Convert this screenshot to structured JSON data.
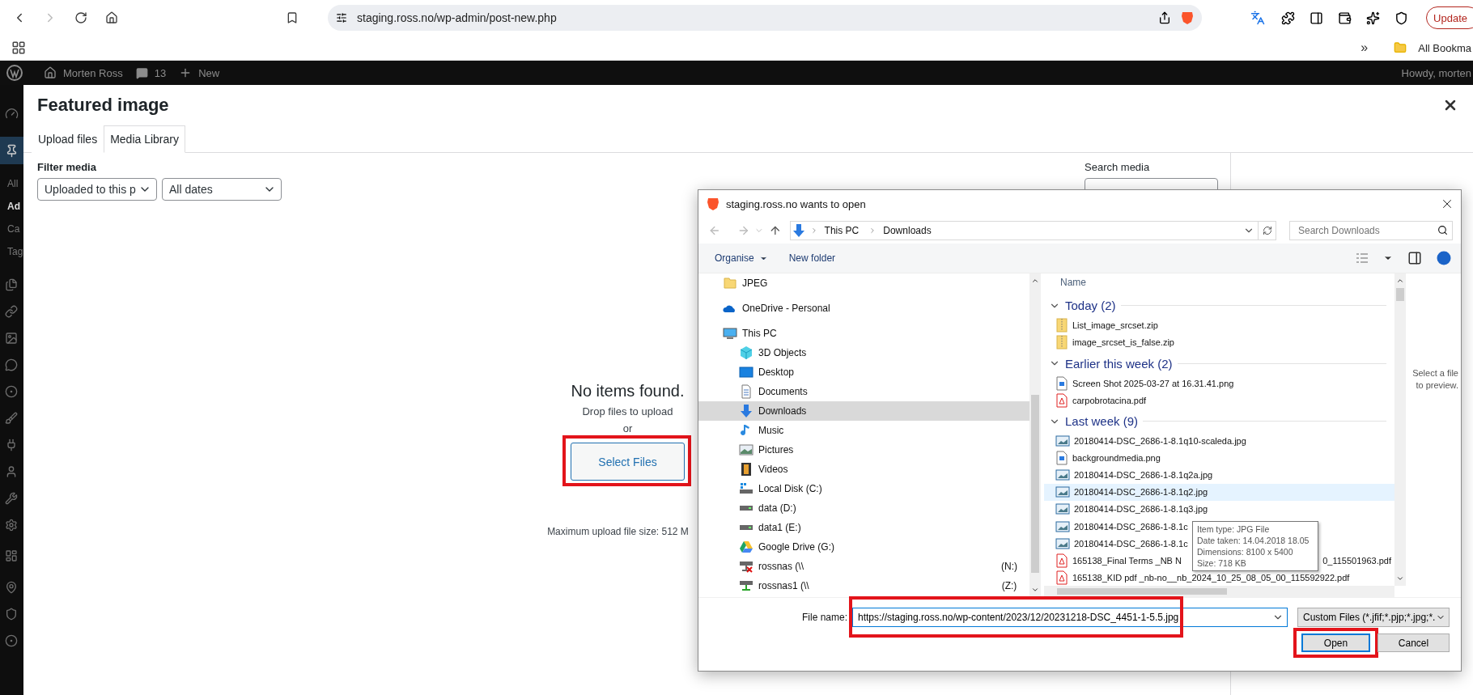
{
  "browser": {
    "url": "staging.ross.no/wp-admin/post-new.php",
    "update_button": "Update",
    "bookmarks_overflow": "»",
    "bookmarks_folder": "All Bookma"
  },
  "admin_bar": {
    "site": "Morten Ross",
    "comments": "13",
    "new": "New",
    "greeting": "Howdy, morten"
  },
  "sidebar": {
    "items": [
      {
        "label": "All",
        "selected": false
      },
      {
        "label": "Ad",
        "selected": true
      },
      {
        "label": "Ca",
        "selected": false
      },
      {
        "label": "Tag",
        "selected": false
      }
    ]
  },
  "modal": {
    "title": "Featured image",
    "tabs": [
      {
        "label": "Upload files",
        "selected": false
      },
      {
        "label": "Media Library",
        "selected": true
      }
    ],
    "filter_label": "Filter media",
    "filters": [
      "Uploaded to this p",
      "All dates"
    ],
    "search_label": "Search media",
    "empty": {
      "title": "No items found.",
      "hint": "Drop files to upload",
      "or": "or",
      "button": {
        "label": "Select Files",
        "highlighted": true
      },
      "max_size": "Maximum upload file size: 512 M"
    }
  },
  "dialog": {
    "title": "staging.ross.no wants to open",
    "path": [
      "This PC",
      "Downloads"
    ],
    "search_placeholder": "Search Downloads",
    "toolbar": {
      "organise": "Organise",
      "new_folder": "New folder"
    },
    "nav_items": [
      {
        "label": "JPEG",
        "kind": "folder",
        "selected": false
      },
      {
        "label": "OneDrive - Personal",
        "kind": "cloud",
        "selected": false
      },
      {
        "label": "This PC",
        "kind": "pc",
        "selected": false,
        "children": [
          {
            "label": "3D Objects",
            "kind": "cube",
            "selected": false
          },
          {
            "label": "Desktop",
            "kind": "desktop",
            "selected": false
          },
          {
            "label": "Documents",
            "kind": "document",
            "selected": false
          },
          {
            "label": "Downloads",
            "kind": "download",
            "selected": true
          },
          {
            "label": "Music",
            "kind": "music",
            "selected": false
          },
          {
            "label": "Pictures",
            "kind": "pictures",
            "selected": false
          },
          {
            "label": "Videos",
            "kind": "video",
            "selected": false
          },
          {
            "label": "Local Disk (C:)",
            "kind": "system-disk",
            "selected": false
          },
          {
            "label": "data (D:)",
            "kind": "disk",
            "selected": false
          },
          {
            "label": "data1 (E:)",
            "kind": "disk",
            "selected": false
          },
          {
            "label": "Google Drive (G:)",
            "kind": "gdrive",
            "selected": false
          },
          {
            "label": "rossnas (\\\\",
            "label_end": "(N:)",
            "kind": "network-drive",
            "disconnected": true,
            "selected": false
          },
          {
            "label": "rossnas1 (\\\\",
            "label_end": "(Z:)",
            "kind": "network-drive",
            "disconnected": false,
            "selected": false
          }
        ]
      }
    ],
    "column": "Name",
    "groups": [
      {
        "label": "Today (2)",
        "expanded": true,
        "files": [
          {
            "name": "List_image_srcset.zip",
            "kind": "zip",
            "selected": false
          },
          {
            "name": "image_srcset_is_false.zip",
            "kind": "zip",
            "selected": false
          }
        ]
      },
      {
        "label": "Earlier this week (2)",
        "expanded": true,
        "files": [
          {
            "name": "Screen Shot 2025-03-27 at 16.31.41.png",
            "kind": "png",
            "selected": false
          },
          {
            "name": "carpobrotacina.pdf",
            "kind": "pdf",
            "selected": false
          }
        ]
      },
      {
        "label": "Last week (9)",
        "expanded": true,
        "files": [
          {
            "name": "20180414-DSC_2686-1-8.1q10-scaleda.jpg",
            "kind": "jpg",
            "selected": false
          },
          {
            "name": "backgroundmedia.png",
            "kind": "png",
            "selected": false
          },
          {
            "name": "20180414-DSC_2686-1-8.1q2a.jpg",
            "kind": "jpg",
            "selected": false
          },
          {
            "name": "20180414-DSC_2686-1-8.1q2.jpg",
            "kind": "jpg",
            "selected": true
          },
          {
            "name": "20180414-DSC_2686-1-8.1q3.jpg",
            "kind": "jpg",
            "selected": false
          },
          {
            "name": "20180414-DSC_2686-1-8.1c",
            "kind": "jpg",
            "selected": false
          },
          {
            "name": "20180414-DSC_2686-1-8.1c",
            "kind": "jpg",
            "selected": false
          },
          {
            "name": "165138_Final Terms _NB N",
            "name_end": "0_115501963.pdf",
            "kind": "pdf",
            "selected": false
          },
          {
            "name": "165138_KID pdf _nb-no__nb_2024_10_25_08_05_00_115592922.pdf",
            "kind": "pdf",
            "selected": false
          }
        ]
      }
    ],
    "tooltip": [
      "Item type: JPG File",
      "Date taken: 14.04.2018 18.05",
      "Dimensions: 8100 x 5400",
      "Size: 718 KB"
    ],
    "preview": "Select a file to preview.",
    "file_name_label": "File name:",
    "file_name": {
      "value": "https://staging.ross.no/wp-content/2023/12/20231218-DSC_4451-1-5.5.jpg",
      "highlighted": true
    },
    "file_type": "Custom Files (*.jfif;*.pjp;*.jpg;*.",
    "buttons": [
      {
        "label": "Open",
        "kind": "default",
        "highlighted": true
      },
      {
        "label": "Cancel",
        "kind": "normal",
        "highlighted": false
      }
    ]
  }
}
